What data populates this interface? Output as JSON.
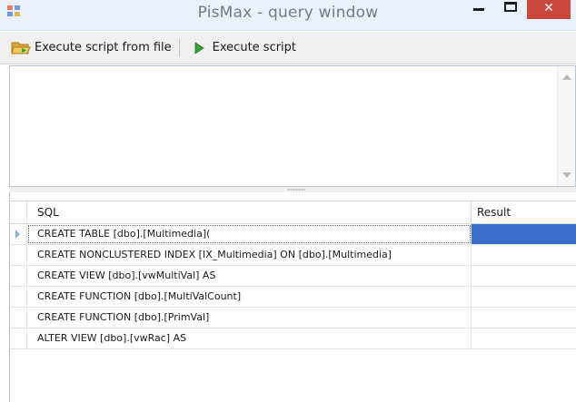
{
  "window": {
    "title": "PisMax - query window",
    "close_glyph": "✕"
  },
  "toolbar": {
    "items": [
      {
        "label": "Execute script from file",
        "icon": "folder-open-icon"
      },
      {
        "label": "Execute script",
        "icon": "play-icon"
      }
    ]
  },
  "editor": {
    "value": ""
  },
  "grid": {
    "columns": [
      "SQL",
      "Result"
    ],
    "rows": [
      {
        "sql": "CREATE TABLE [dbo].[Multimedia](",
        "result": "",
        "selected": true
      },
      {
        "sql": "CREATE NONCLUSTERED INDEX [IX_Multimedia] ON [dbo].[Multimedia]",
        "result": ""
      },
      {
        "sql": "CREATE VIEW [dbo].[vwMultiVal] AS",
        "result": ""
      },
      {
        "sql": "CREATE FUNCTION [dbo].[MultiValCount]",
        "result": ""
      },
      {
        "sql": "CREATE FUNCTION [dbo].[PrimVal]",
        "result": ""
      },
      {
        "sql": "ALTER VIEW [dbo].[vwRac] AS",
        "result": ""
      }
    ]
  },
  "colors": {
    "selection": "#3a6fcb",
    "close_button": "#c9473d",
    "play_icon": "#35a33a",
    "folder_icon": "#e3b64a"
  }
}
